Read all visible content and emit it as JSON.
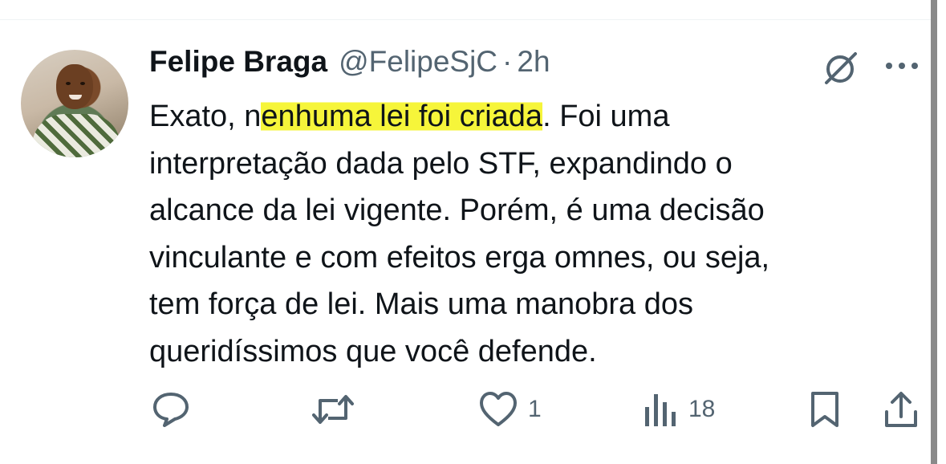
{
  "tweet": {
    "author_name": "Felipe Braga",
    "handle": "@FelipeSjC",
    "separator": "·",
    "time": "2h",
    "text_pre": "Exato, n",
    "text_highlight": "enhuma lei foi criada",
    "text_post": ". Foi uma\ninterpretação dada pelo STF, expandindo o\nalcance da lei vigente. Porém, é uma decisão\nvinculante e com efeitos erga omnes, ou seja,\ntem força de lei. Mais uma manobra dos\nqueridíssimos que você defende.",
    "highlight_color": "#f6f53a"
  },
  "actions": {
    "reply_count": "",
    "retweet_count": "",
    "like_count": "1",
    "views_count": "18"
  },
  "icons": {
    "header": [
      "grok-icon",
      "more-icon"
    ],
    "actions": [
      "reply-icon",
      "retweet-icon",
      "like-icon",
      "views-icon",
      "bookmark-icon",
      "share-icon"
    ]
  },
  "colors": {
    "text": "#0f1419",
    "secondary": "#536471"
  }
}
